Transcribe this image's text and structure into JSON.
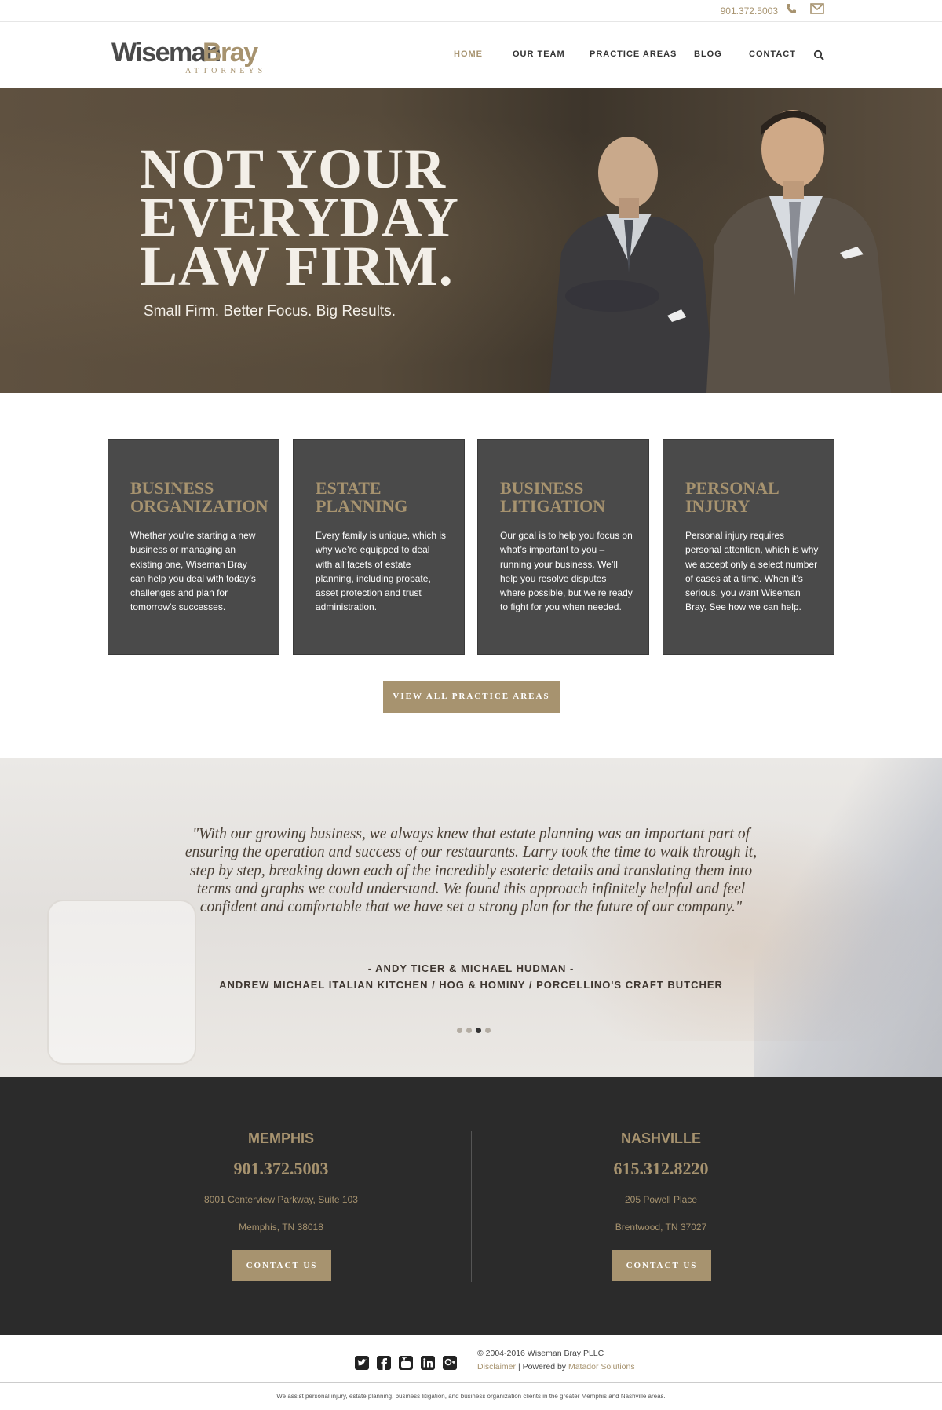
{
  "topbar": {
    "phone": "901.372.5003",
    "phone_icon": "phone-icon",
    "mail_icon": "mail-icon"
  },
  "brand": {
    "name_part1": "Wiseman",
    "name_part2": "Bray",
    "subtitle": "ATTORNEYS"
  },
  "nav": {
    "items": [
      {
        "label": "HOME",
        "active": true
      },
      {
        "label": "OUR TEAM",
        "active": false
      },
      {
        "label": "PRACTICE AREAS",
        "active": false
      },
      {
        "label": "BLOG",
        "active": false
      },
      {
        "label": "CONTACT",
        "active": false
      }
    ],
    "search_icon": "search-icon"
  },
  "hero": {
    "headline_line1": "NOT YOUR",
    "headline_line2": "EVERYDAY",
    "headline_line3": "LAW FIRM.",
    "tagline": "Small Firm. Better Focus. Big Results."
  },
  "practice_areas": [
    {
      "title_line1": "BUSINESS",
      "title_line2": "ORGANIZATION",
      "body": "Whether you’re starting a new business or managing an existing one, Wiseman Bray can help you deal with today’s challenges and plan for tomorrow’s successes."
    },
    {
      "title_line1": "ESTATE",
      "title_line2": "PLANNING",
      "body": "Every family is unique, which is why we’re equipped to deal with all facets of estate planning, including probate, asset protection and trust administration."
    },
    {
      "title_line1": "BUSINESS",
      "title_line2": "LITIGATION",
      "body": "Our goal is to help you focus on what’s important to you – running your business. We’ll help you resolve disputes where possible, but we’re ready to fight for you when needed."
    },
    {
      "title_line1": "PERSONAL",
      "title_line2": "INJURY",
      "body": "Personal injury requires personal attention, which is why we accept only a select number of cases at a time. When it’s serious, you want Wiseman Bray. See how we can help."
    }
  ],
  "view_all_label": "VIEW ALL PRACTICE AREAS",
  "testimonial": {
    "quote": "\"With our growing business, we always knew that estate planning was an important part of ensuring the operation and success of our restaurants. Larry took the time to walk through it, step by step, breaking down each of the incredibly esoteric details and translating them into terms and graphs we could understand. We found this approach infinitely helpful and feel confident and comfortable that we have set a strong plan for the future of our company.\"",
    "author": "- ANDY TICER & MICHAEL HUDMAN -",
    "company": "ANDREW MICHAEL ITALIAN KITCHEN / HOG & HOMINY / PORCELLINO'S CRAFT BUTCHER",
    "slide_count": 4,
    "active_slide": 3
  },
  "offices": [
    {
      "city": "MEMPHIS",
      "phone": "901.372.5003",
      "address1": "8001 Centerview Parkway, Suite 103",
      "address2": "Memphis, TN 38018",
      "button": "CONTACT US"
    },
    {
      "city": "NASHVILLE",
      "phone": "615.312.8220",
      "address1": "205 Powell Place",
      "address2": "Brentwood, TN 37027",
      "button": "CONTACT US"
    }
  ],
  "footer": {
    "social_icons": [
      "twitter-icon",
      "facebook-icon",
      "youtube-icon",
      "linkedin-icon",
      "google-plus-icon"
    ],
    "copyright": "© 2004-2016 Wiseman Bray PLLC",
    "disclaimer": "Disclaimer",
    "separator": "|",
    "powered_by": "Powered by",
    "powered_by_link": "Matador Solutions",
    "bottom_text": "We assist personal injury, estate planning, business litigation, and business organization clients in the greater Memphis and Nashville areas."
  },
  "colors": {
    "accent": "#a7936f",
    "card_bg": "#4a4a4a",
    "dark_bg": "#2b2b2b"
  }
}
